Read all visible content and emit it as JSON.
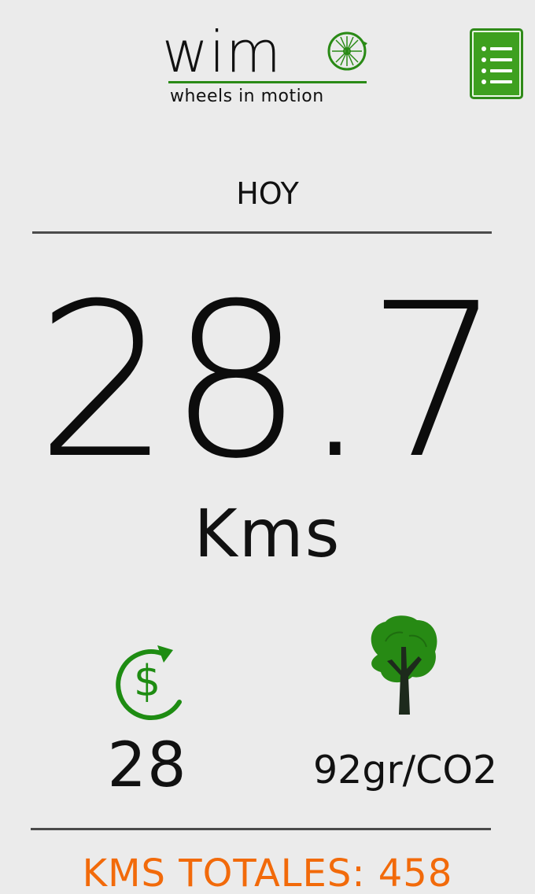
{
  "header": {
    "logo_word": "wim",
    "logo_tagline": "wheels in motion",
    "menu_icon": "list-menu-icon"
  },
  "summary": {
    "period": "HOY",
    "distance": "28.7",
    "unit": "Kms"
  },
  "stats": {
    "savings_icon": "currency-refresh-icon",
    "savings_value": "28",
    "environment_icon": "tree-icon",
    "co2_value": "92gr/CO2"
  },
  "footer": {
    "total_distance": "KMS TOTALES: 458"
  },
  "colors": {
    "background": "#ebebeb",
    "brand_green": "#2a8a16",
    "accent_orange": "#f26a0a"
  }
}
